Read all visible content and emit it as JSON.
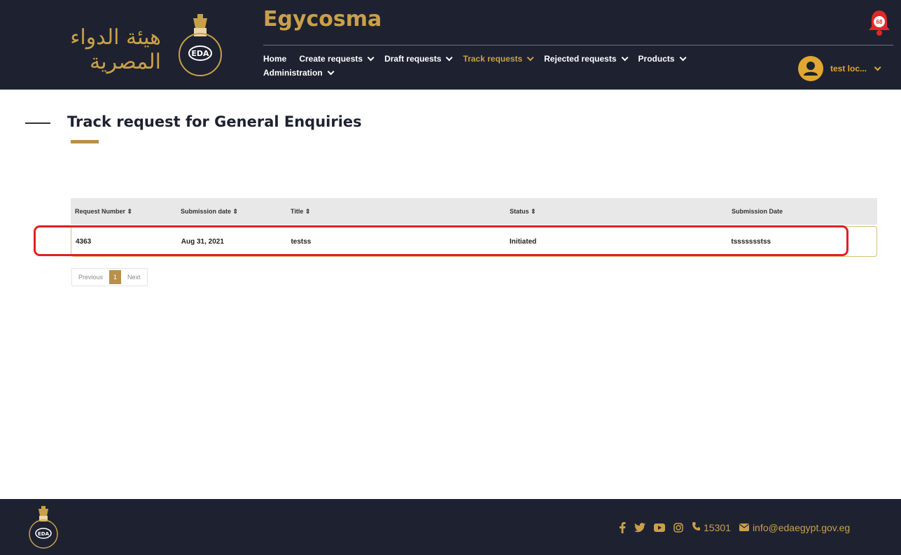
{
  "header": {
    "arabic_logo_text": "هيئة الدواء المصرية",
    "app_title": "Egycosma",
    "notification_count": "68",
    "user_name": "test loc...",
    "nav": [
      {
        "label": "Home",
        "has_dropdown": false,
        "active": false
      },
      {
        "label": "Create requests",
        "has_dropdown": true,
        "active": false
      },
      {
        "label": "Draft requests",
        "has_dropdown": true,
        "active": false
      },
      {
        "label": "Track requests",
        "has_dropdown": true,
        "active": true
      },
      {
        "label": "Rejected requests",
        "has_dropdown": true,
        "active": false
      },
      {
        "label": "Products",
        "has_dropdown": true,
        "active": false
      },
      {
        "label": "Administration",
        "has_dropdown": true,
        "active": false
      }
    ]
  },
  "page": {
    "title": "Track request for General Enquiries"
  },
  "table": {
    "columns": [
      "Request Number ⇕",
      "Submission date ⇕",
      "Title ⇕",
      "Status ⇕",
      "Submission Date"
    ],
    "rows": [
      [
        "4363",
        "Aug 31, 2021",
        "testss",
        "Initiated",
        "tssssssstss"
      ]
    ]
  },
  "pagination": {
    "previous": "Previous",
    "current": "1",
    "next": "Next"
  },
  "footer": {
    "social_icons": [
      "facebook-icon",
      "twitter-icon",
      "youtube-icon",
      "instagram-icon"
    ],
    "phone": "15301",
    "email": "info@edaegypt.gov.eg"
  },
  "colors": {
    "navy": "#1e2230",
    "gold": "#c9a04a",
    "highlight_red": "#e02020"
  }
}
